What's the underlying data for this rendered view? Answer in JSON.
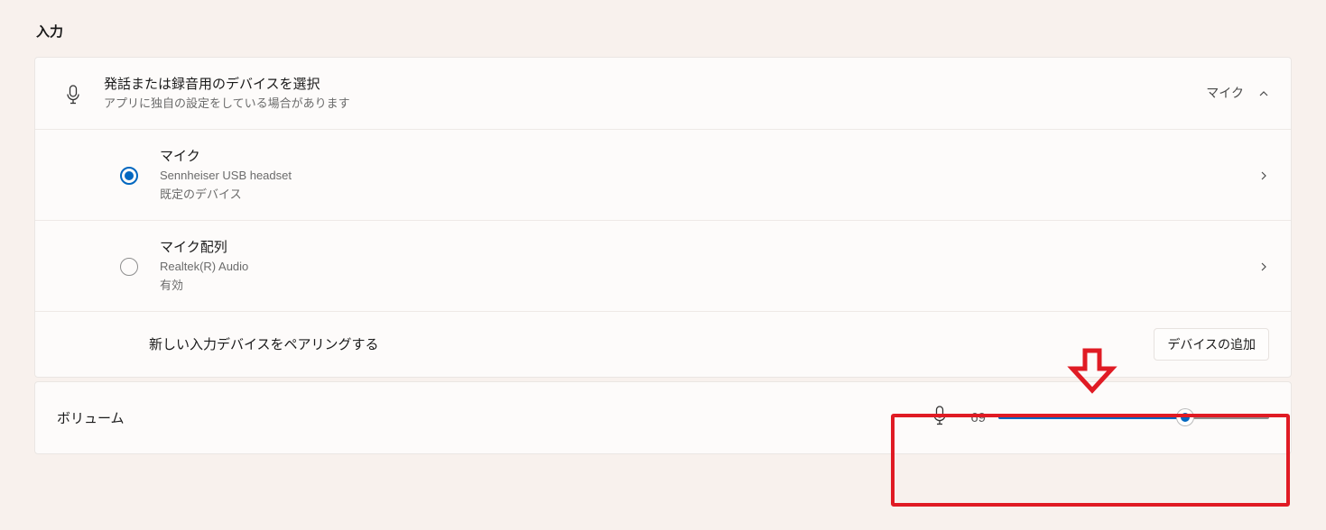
{
  "section_heading": "入力",
  "input_device": {
    "title": "発話または録音用のデバイスを選択",
    "subtitle": "アプリに独自の設定をしている場合があります",
    "right_label": "マイク"
  },
  "devices": [
    {
      "name": "マイク",
      "detail": "Sennheiser USB headset",
      "status": "既定のデバイス",
      "selected": true
    },
    {
      "name": "マイク配列",
      "detail": "Realtek(R) Audio",
      "status": "有効",
      "selected": false
    }
  ],
  "pair_row": {
    "label": "新しい入力デバイスをペアリングする",
    "button": "デバイスの追加"
  },
  "volume": {
    "label": "ボリューム",
    "value": 69,
    "max": 100
  }
}
